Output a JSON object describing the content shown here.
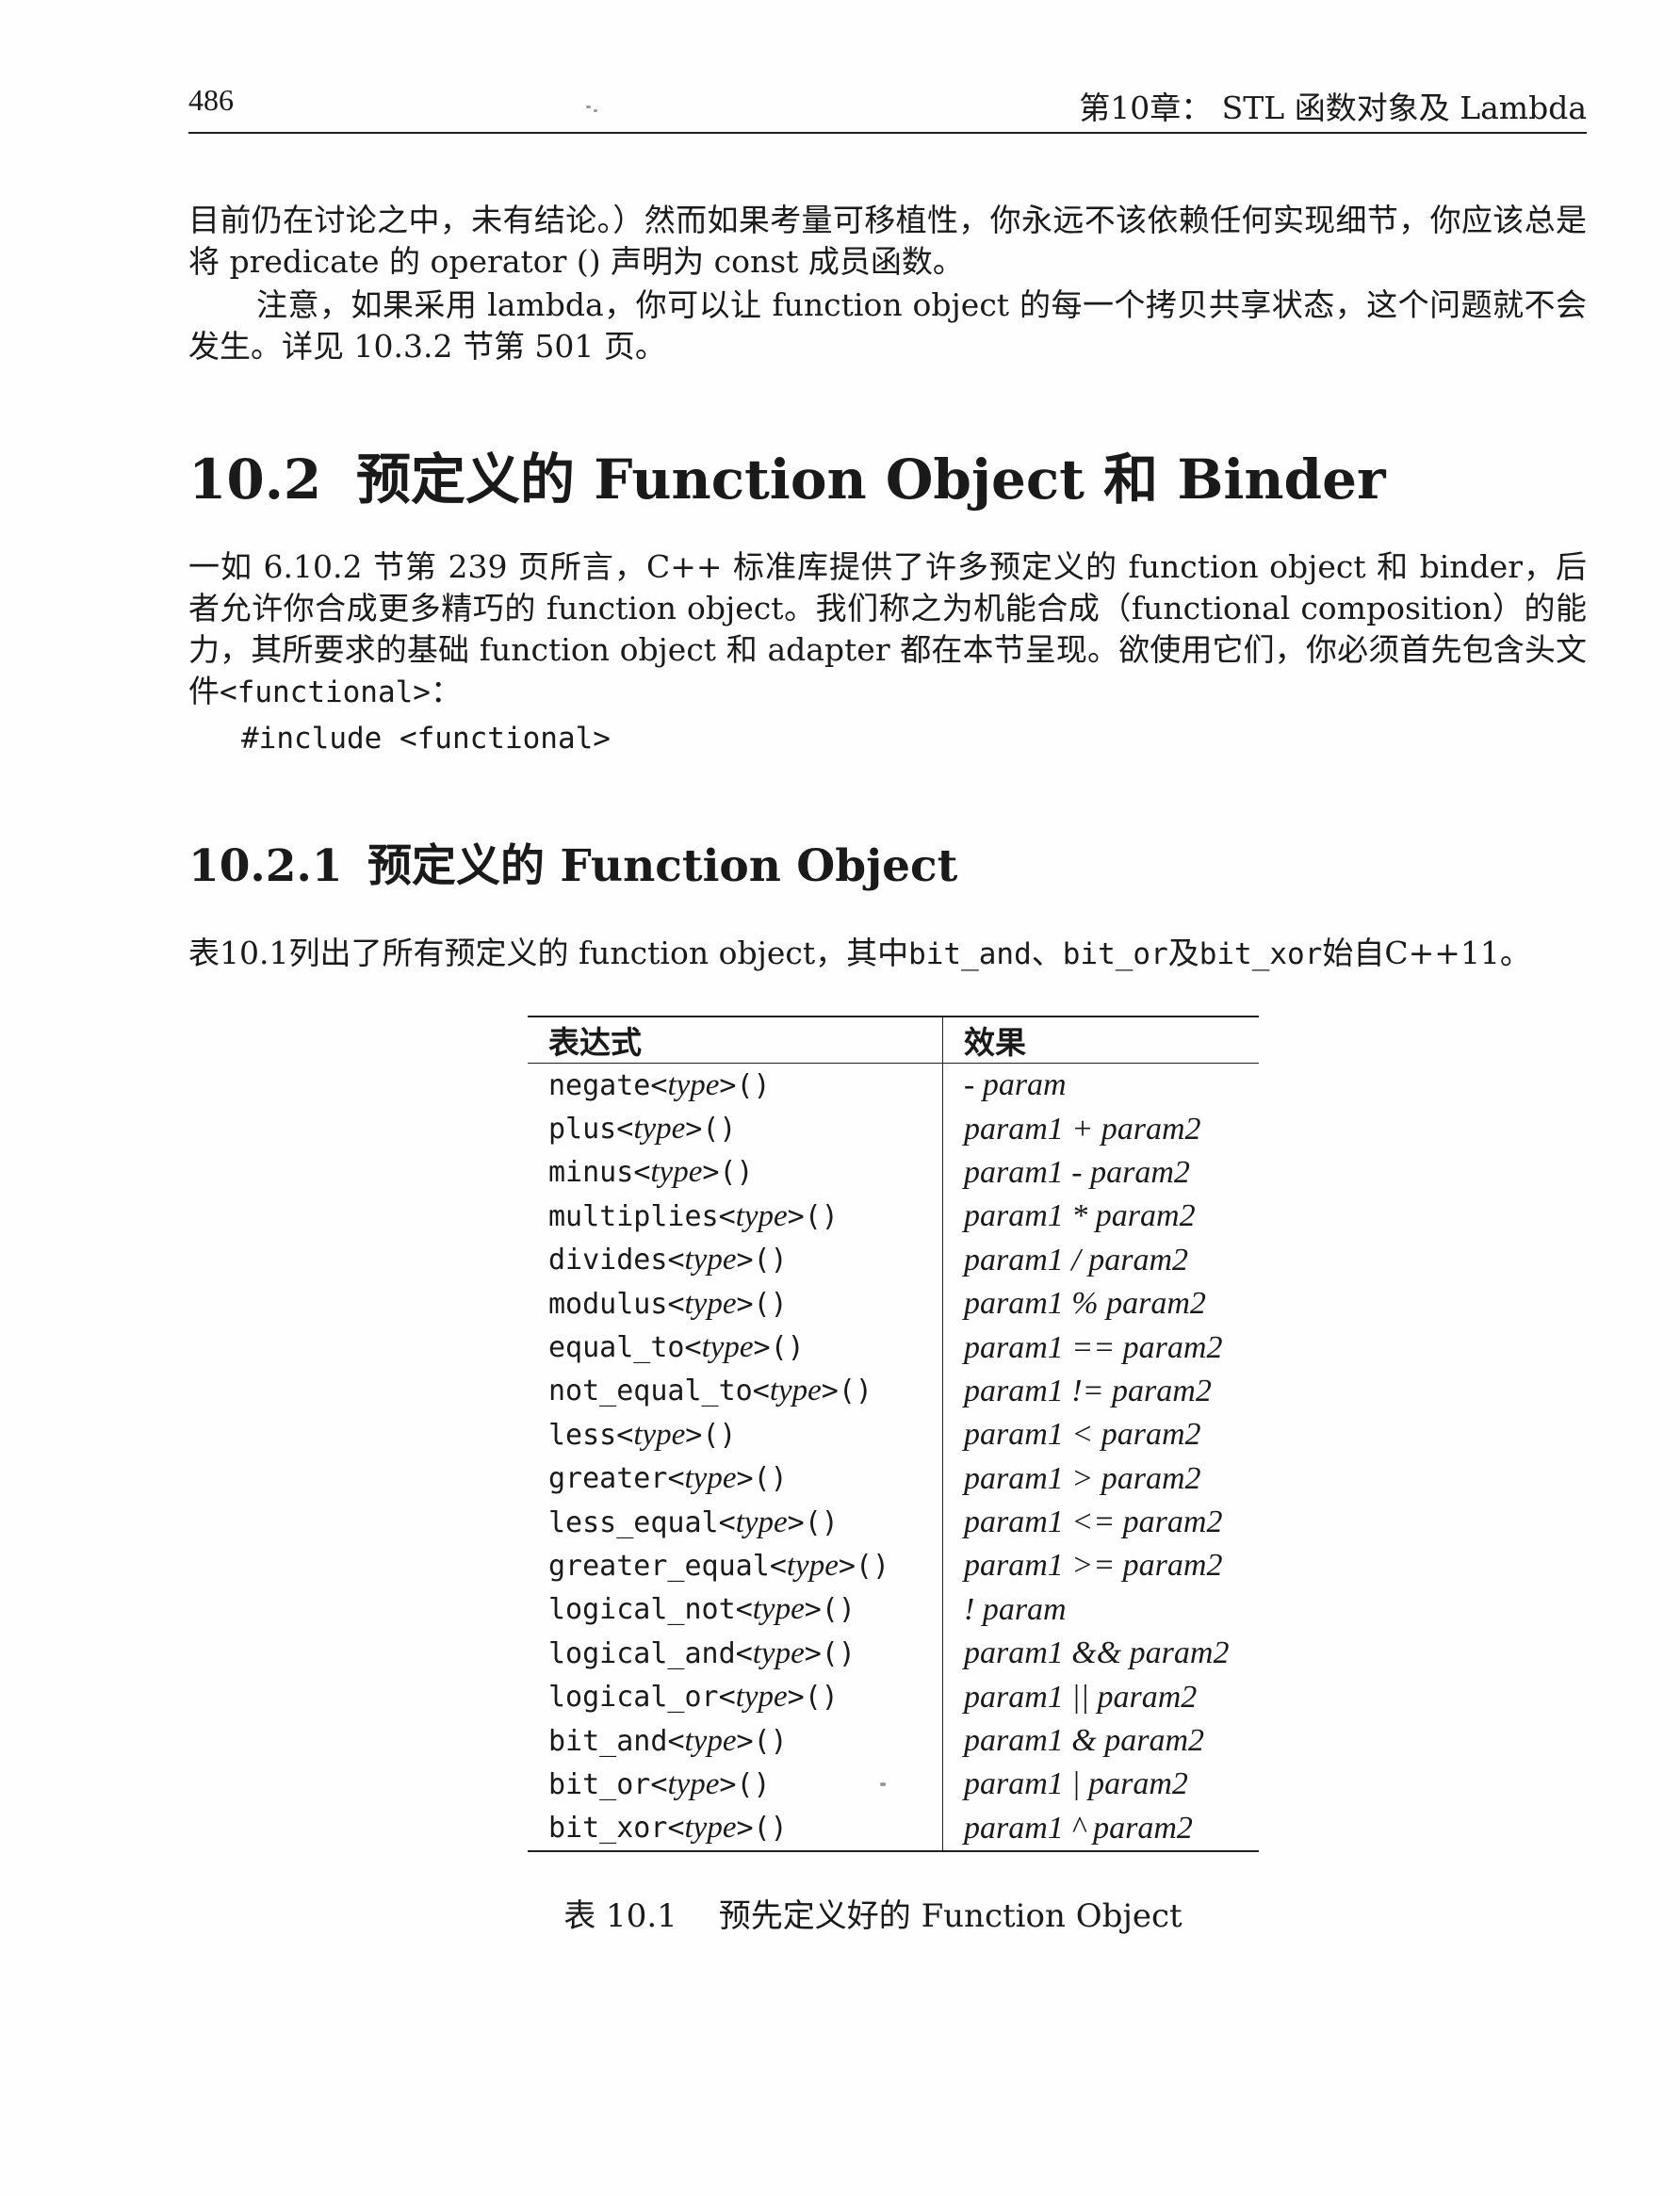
{
  "header": {
    "page_number": "486",
    "chapter_title": "第10章： STL 函数对象及 Lambda"
  },
  "paragraphs": {
    "p1": "目前仍在讨论之中，未有结论。）然而如果考量可移植性，你永远不该依赖任何实现细节，你应该总是将 predicate 的 operator () 声明为 const 成员函数。",
    "p2": "注意，如果采用 lambda，你可以让 function object 的每一个拷贝共享状态，这个问题就不会发生。详见 10.3.2 节第 501 页。",
    "p3_text": "一如 6.10.2 节第 239 页所言，C++ 标准库提供了许多预定义的 function object 和 binder，后者允许你合成更多精巧的 function object。我们称之为机能合成（functional composition）的能力，其所要求的基础 function object 和 adapter 都在本节呈现。欲使用它们，你必须首先包含头文件",
    "p3_code": "<functional>",
    "p3_end": "：",
    "p4_text1": "表10.1列出了所有预定义的 function object，其中",
    "p4_code1": "bit_and",
    "p4_sep1": "、",
    "p4_code2": "bit_or",
    "p4_sep2": "及",
    "p4_code3": "bit_xor",
    "p4_text2": "始自C++11。"
  },
  "code_line": "#include <functional>",
  "section": {
    "number": "10.2",
    "title": "预定义的 Function Object 和 Binder"
  },
  "subsection": {
    "number": "10.2.1",
    "title": "预定义的 Function Object"
  },
  "table": {
    "headers": [
      "表达式",
      "效果"
    ],
    "rows": [
      {
        "name": "negate",
        "tparam": "type",
        "parens": "()",
        "effect": "- param"
      },
      {
        "name": "plus",
        "tparam": "type",
        "parens": "()",
        "effect": "param1 + param2"
      },
      {
        "name": "minus",
        "tparam": "type",
        "parens": "()",
        "effect": "param1 - param2"
      },
      {
        "name": "multiplies",
        "tparam": "type",
        "parens": "()",
        "effect": "param1 * param2"
      },
      {
        "name": "divides",
        "tparam": "type",
        "parens": "()",
        "effect": "param1 / param2"
      },
      {
        "name": "modulus",
        "tparam": "type",
        "parens": "()",
        "effect": "param1 % param2"
      },
      {
        "name": "equal_to",
        "tparam": "type",
        "parens": "()",
        "effect": "param1 == param2"
      },
      {
        "name": "not_equal_to",
        "tparam": "type",
        "parens": "()",
        "effect": "param1 != param2"
      },
      {
        "name": "less",
        "tparam": "type",
        "parens": "()",
        "effect": "param1 < param2"
      },
      {
        "name": "greater",
        "tparam": "type",
        "parens": "()",
        "effect": "param1 > param2"
      },
      {
        "name": "less_equal",
        "tparam": "type",
        "parens": "()",
        "effect": "param1 <= param2"
      },
      {
        "name": "greater_equal",
        "tparam": "type",
        "parens": "()",
        "effect": "param1 >= param2"
      },
      {
        "name": "logical_not",
        "tparam": "type",
        "parens": "()",
        "effect": "! param"
      },
      {
        "name": "logical_and",
        "tparam": "type",
        "parens": "()",
        "effect": "param1 && param2"
      },
      {
        "name": "logical_or",
        "tparam": "type",
        "parens": "()",
        "effect": "param1 || param2"
      },
      {
        "name": "bit_and",
        "tparam": "type",
        "parens": "()",
        "effect": "param1 & param2"
      },
      {
        "name": "bit_or",
        "tparam": "type",
        "parens": "()",
        "effect": "param1 | param2"
      },
      {
        "name": "bit_xor",
        "tparam": "type",
        "parens": "()",
        "effect": "param1 ^ param2"
      }
    ],
    "caption_number": "表 10.1",
    "caption_title": "预先定义好的 Function Object"
  }
}
